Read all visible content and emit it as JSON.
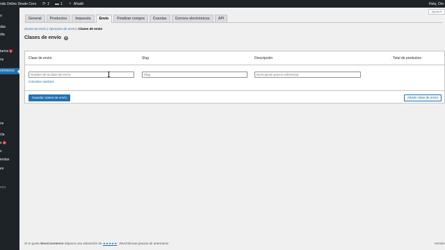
{
  "adminbar": {
    "site_name": "nda Online Desde Cero",
    "updates_count": "2",
    "comments_count": "1",
    "new_label": "Añadir",
    "greeting": "Hola, Om"
  },
  "sidebar": {
    "items": [
      {
        "label": "o"
      },
      {
        "label": "das"
      },
      {
        "label": "dia"
      },
      {
        "label": "tarios",
        "badge": "1"
      },
      {
        "label": "os"
      },
      {
        "label": "ommerce"
      },
      {
        "label": "os"
      },
      {
        "label": "cia"
      },
      {
        "label": "s",
        "badge": "2"
      },
      {
        "label": "s"
      },
      {
        "label": "ientas"
      },
      {
        "label": "es"
      },
      {
        "label": "enú"
      }
    ]
  },
  "help_label": "Ayuda",
  "tabs": [
    {
      "label": "General"
    },
    {
      "label": "Productos"
    },
    {
      "label": "Impuesto"
    },
    {
      "label": "Envío"
    },
    {
      "label": "Finalizar compra"
    },
    {
      "label": "Cuentas"
    },
    {
      "label": "Correos electrónicos"
    },
    {
      "label": "API"
    }
  ],
  "subsubsub": {
    "link1": "Zonas de envío",
    "sep": "|",
    "link2": "Opciones de envío",
    "current": "Clases de envío"
  },
  "page_title": "Clases de envío",
  "table": {
    "headers": {
      "name": "Clase de envío",
      "slug": "Slug",
      "description": "Descripción",
      "count": "Total de productos"
    },
    "row": {
      "name_placeholder": "Nombre de la clase de envío",
      "slug_placeholder": "Slug",
      "description_placeholder": "Descripción para tu referencia",
      "cancel_label": "Cancelar cambios"
    }
  },
  "buttons": {
    "save": "Guardar clases de envío",
    "add": "Añade clase de envío"
  },
  "footer": {
    "text_before": "Si te gusta",
    "brand": "WooCommerce",
    "text_middle": "déjanos una valoración de",
    "stars": "★★★★★",
    "text_after": ". ¡Muchísimas gracias de antemano!",
    "version": "Versión"
  }
}
